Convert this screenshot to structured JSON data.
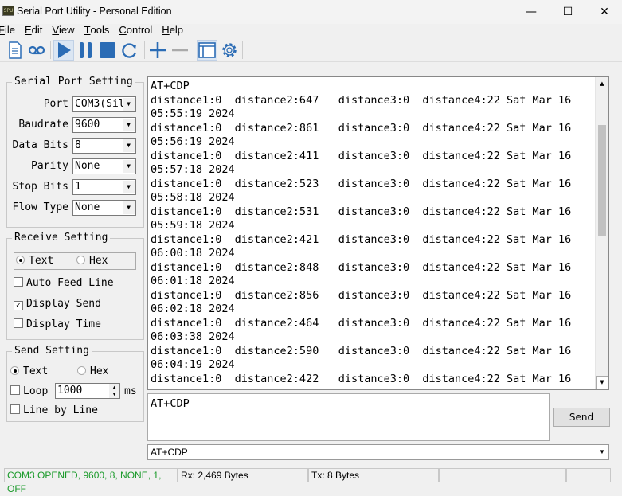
{
  "window": {
    "title": "Serial Port Utility - Personal Edition",
    "icon_text": "SPU",
    "min": "—",
    "max": "☐",
    "close": "✕"
  },
  "menu": [
    {
      "label": "File",
      "u": "F",
      "rest": "ile"
    },
    {
      "label": "Edit",
      "u": "E",
      "rest": "dit"
    },
    {
      "label": "View",
      "u": "V",
      "rest": "iew"
    },
    {
      "label": "Tools",
      "u": "T",
      "rest": "ools"
    },
    {
      "label": "Control",
      "u": "C",
      "rest": "ontrol"
    },
    {
      "label": "Help",
      "u": "H",
      "rest": "elp"
    }
  ],
  "toolbar": {
    "icons": [
      "new-document-icon",
      "record-icon",
      "play-icon",
      "pause-icon",
      "stop-icon",
      "refresh-icon",
      "add-icon",
      "remove-icon",
      "window-icon",
      "settings-gear-icon"
    ],
    "accent": "#2b6cb5"
  },
  "serial": {
    "title": "Serial Port Setting",
    "fields": [
      {
        "label": "Port",
        "value": "COM3(Sil"
      },
      {
        "label": "Baudrate",
        "value": "9600"
      },
      {
        "label": "Data Bits",
        "value": "8"
      },
      {
        "label": "Parity",
        "value": "None"
      },
      {
        "label": "Stop Bits",
        "value": "1"
      },
      {
        "label": "Flow Type",
        "value": "None"
      }
    ]
  },
  "receive": {
    "title": "Receive Setting",
    "text": "Text",
    "hex": "Hex",
    "mode": "Text",
    "auto_feed": "Auto Feed Line",
    "auto_feed_checked": false,
    "display_send": "Display Send",
    "display_send_checked": true,
    "display_time": "Display Time",
    "display_time_checked": false
  },
  "send": {
    "title": "Send Setting",
    "text": "Text",
    "hex": "Hex",
    "mode": "Text",
    "loop": "Loop",
    "loop_checked": false,
    "loop_value": "1000",
    "ms": "ms",
    "line_by_line": "Line by Line",
    "line_by_line_checked": false
  },
  "output": {
    "lines": [
      "AT+CDP",
      "distance1:0  distance2:647   distance3:0  distance4:22 Sat Mar 16",
      "05:55:19 2024",
      "distance1:0  distance2:861   distance3:0  distance4:22 Sat Mar 16",
      "05:56:19 2024",
      "distance1:0  distance2:411   distance3:0  distance4:22 Sat Mar 16",
      "05:57:18 2024",
      "distance1:0  distance2:523   distance3:0  distance4:22 Sat Mar 16",
      "05:58:18 2024",
      "distance1:0  distance2:531   distance3:0  distance4:22 Sat Mar 16",
      "05:59:18 2024",
      "distance1:0  distance2:421   distance3:0  distance4:22 Sat Mar 16",
      "06:00:18 2024",
      "distance1:0  distance2:848   distance3:0  distance4:22 Sat Mar 16",
      "06:01:18 2024",
      "distance1:0  distance2:856   distance3:0  distance4:22 Sat Mar 16",
      "06:02:18 2024",
      "distance1:0  distance2:464   distance3:0  distance4:22 Sat Mar 16",
      "06:03:38 2024",
      "distance1:0  distance2:590   distance3:0  distance4:22 Sat Mar 16",
      "06:04:19 2024",
      "distance1:0  distance2:422   distance3:0  distance4:22 Sat Mar 16"
    ]
  },
  "input": {
    "value": "AT+CDP"
  },
  "send_button": "Send",
  "history": {
    "value": "AT+CDP"
  },
  "status": {
    "port": "COM3 OPENED, 9600, 8, NONE, 1, OFF",
    "port_color": "#1a9a2a",
    "rx": "Rx: 2,469 Bytes",
    "tx": "Tx: 8 Bytes"
  }
}
